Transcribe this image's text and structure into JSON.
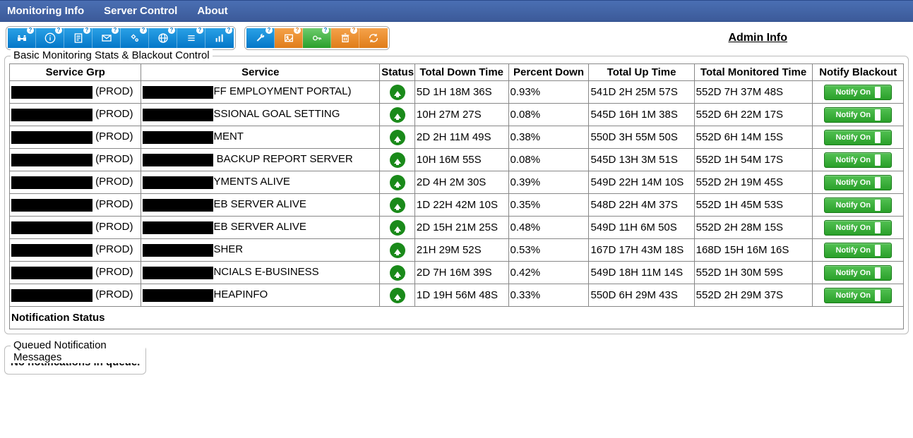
{
  "menu": {
    "monitoring": "Monitoring Info",
    "server": "Server Control",
    "about": "About"
  },
  "admin_link": "Admin Info",
  "panel_title": "Basic Monitoring Stats & Blackout Control",
  "columns": {
    "grp": "Service Grp",
    "service": "Service",
    "status": "Status",
    "down": "Total Down Time",
    "pct": "Percent Down",
    "up": "Total Up Time",
    "mon": "Total Monitored Time",
    "notify": "Notify Blackout"
  },
  "notify_label": "Notify On",
  "notification_status_label": "Notification Status",
  "queue": {
    "title": "Queued Notification Messages",
    "empty": "No notifications in queue."
  },
  "rows": [
    {
      "grp_suffix": " (PROD)",
      "svc_suffix": "FF EMPLOYMENT PORTAL)",
      "status": "up",
      "down": "5D 1H 18M 36S",
      "pct": "0.93%",
      "up": "541D 2H 25M 57S",
      "mon": "552D 7H 37M 48S"
    },
    {
      "grp_suffix": " (PROD)",
      "svc_suffix": "SSIONAL GOAL SETTING",
      "status": "up",
      "down": "10H 27M 27S",
      "pct": "0.08%",
      "up": "545D 16H 1M 38S",
      "mon": "552D 6H 22M 17S"
    },
    {
      "grp_suffix": " (PROD)",
      "svc_suffix": "MENT",
      "status": "up",
      "down": "2D 2H 11M 49S",
      "pct": "0.38%",
      "up": "550D 3H 55M 50S",
      "mon": "552D 6H 14M 15S"
    },
    {
      "grp_suffix": " (PROD)",
      "svc_suffix": " BACKUP REPORT SERVER",
      "status": "up",
      "down": "10H 16M 55S",
      "pct": "0.08%",
      "up": "545D 13H 3M 51S",
      "mon": "552D 1H 54M 17S"
    },
    {
      "grp_suffix": " (PROD)",
      "svc_suffix": "YMENTS ALIVE",
      "status": "up",
      "down": "2D 4H 2M 30S",
      "pct": "0.39%",
      "up": "549D 22H 14M 10S",
      "mon": "552D 2H 19M 45S"
    },
    {
      "grp_suffix": " (PROD)",
      "svc_suffix": "EB SERVER ALIVE",
      "status": "up",
      "down": "1D 22H 42M 10S",
      "pct": "0.35%",
      "up": "548D 22H 4M 37S",
      "mon": "552D 1H 45M 53S"
    },
    {
      "grp_suffix": " (PROD)",
      "svc_suffix": "EB SERVER ALIVE",
      "status": "up",
      "down": "2D 15H 21M 25S",
      "pct": "0.48%",
      "up": "549D 11H 6M 50S",
      "mon": "552D 2H 28M 15S"
    },
    {
      "grp_suffix": " (PROD)",
      "svc_suffix": "SHER",
      "status": "up",
      "down": "21H 29M 52S",
      "pct": "0.53%",
      "up": "167D 17H 43M 18S",
      "mon": "168D 15H 16M 16S"
    },
    {
      "grp_suffix": " (PROD)",
      "svc_suffix": "NCIALS E-BUSINESS",
      "status": "up",
      "down": "2D 7H 16M 39S",
      "pct": "0.42%",
      "up": "549D 18H 11M 14S",
      "mon": "552D 1H 30M 59S"
    },
    {
      "grp_suffix": " (PROD)",
      "svc_suffix": "HEAPINFO",
      "status": "up",
      "down": "1D 19H 56M 48S",
      "pct": "0.33%",
      "up": "550D 6H 29M 43S",
      "mon": "552D 2H 29M 37S"
    }
  ]
}
